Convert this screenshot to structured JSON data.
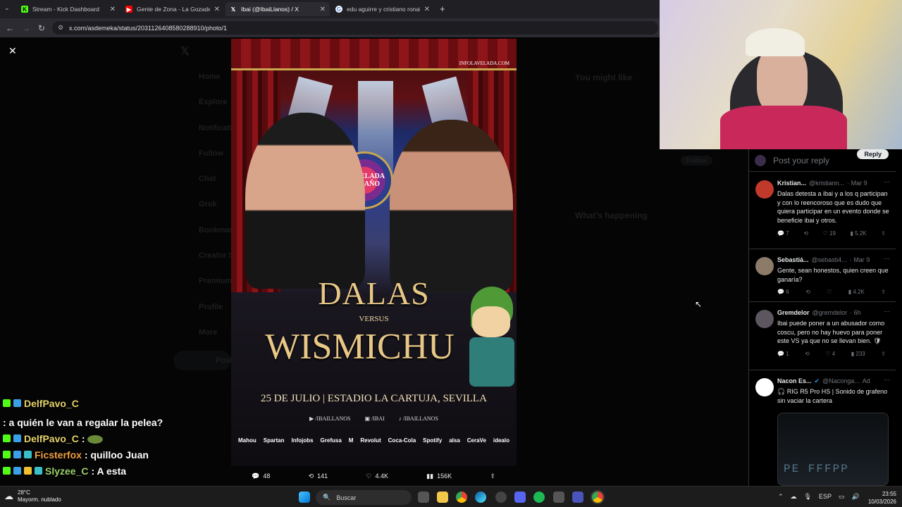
{
  "browser": {
    "tabs": [
      {
        "title": "Stream - Kick Dashboard",
        "icon": "kick-icon",
        "color": "#53fc18"
      },
      {
        "title": "Gente de Zona - La Gozadera (",
        "icon": "youtube-icon",
        "color": "#ff0000"
      },
      {
        "title": "Ibai (@IbaiLlanos) / X",
        "icon": "x-icon",
        "color": "#ffffff"
      },
      {
        "title": "edu aguirre y cristiano ronaldo",
        "icon": "google-icon",
        "color": "#4285f4"
      }
    ],
    "url": "x.com/asdemeka/status/2031126408580288910/photo/1"
  },
  "poster": {
    "site": "INFOLAVELADA.COM",
    "badge": "LA VELADA DEL AÑO",
    "fighter1": "DALAS",
    "versus": "VERSUS",
    "fighter2": "WISMICHU",
    "date_venue": "25 DE JULIO  |  ESTADIO LA CARTUJA, SEVILLA",
    "socials": [
      "/IBAILLANOS",
      "/IBAI",
      "/IBAILLANOS"
    ],
    "sponsors": [
      "Mahou",
      "Spartan",
      "Infojobs",
      "Grefusa",
      "M",
      "Revolut",
      "Coca-Cola",
      "Spotify",
      "alsa",
      "CeraVe",
      "idealo"
    ]
  },
  "tweet_actions": {
    "replies": "48",
    "reposts": "141",
    "likes": "4.4K",
    "views": "156K"
  },
  "reply_panel": {
    "placeholder": "Post your reply",
    "reply_button": "Reply",
    "items": [
      {
        "name": "Kristian...",
        "handle": "@kristiann...",
        "time": "· Mar 9",
        "text": "Dalas detesta a ibai y a los q participan y con lo reencoroso que es dudo que quiera participar en un evento donde se beneficie ibai y otros.",
        "replies": "7",
        "reposts": "",
        "likes": "19",
        "views": "5.2K",
        "avatar_color": "#c0392b"
      },
      {
        "name": "Sebastiá...",
        "handle": "@sebasti4...",
        "time": "· Mar 9",
        "text": "Gente, sean honestos, quien creen que ganaría?",
        "replies": "6",
        "reposts": "",
        "likes": "",
        "views": "4.2K",
        "avatar_color": "#8d7b6a"
      },
      {
        "name": "Gremdelor",
        "handle": "@gremdelor",
        "time": "· 6h",
        "text": "Ibai puede poner a un abusador como coscu, pero no hay huevo para poner este VS ya que no se llevan bien. 🛡",
        "replies": "1",
        "reposts": "",
        "likes": "4",
        "views": "233",
        "avatar_color": "#5d5660"
      },
      {
        "name": "Nacon Es...",
        "handle": "@Naconga...",
        "time": "Ad",
        "text": "🎧 RIG R5 Pro HS | Sonido de grafeno sin vaciar la cartera",
        "replies": "",
        "reposts": "",
        "likes": "",
        "views": "",
        "avatar_color": "#ffffff"
      }
    ],
    "ad_media_text": "PE FFFPP"
  },
  "background_page": {
    "nav": [
      "Home",
      "Explore",
      "Notifications",
      "Follow",
      "Chat",
      "Grok",
      "Bookmarks",
      "Creator Studio",
      "Premium",
      "Profile",
      "More"
    ],
    "post_button": "Post",
    "you_might_like": "You might like",
    "whats_happening": "What's happening",
    "follow": "Follow"
  },
  "chat": [
    {
      "user": "DelfPavo_C",
      "message": ": a quién le van a regalar la pelea?"
    },
    {
      "user": "DelfPavo_C",
      "message": ":"
    },
    {
      "user": "Ficsterfox",
      "message": ": quilloo Juan"
    },
    {
      "user": "Slyzee_C",
      "message": ": A esta"
    }
  ],
  "taskbar": {
    "temperature": "28°C",
    "weather": "Mayorm. nublado",
    "search": "Buscar",
    "language": "ESP",
    "time": "23:55",
    "date": "10/03/2026"
  }
}
